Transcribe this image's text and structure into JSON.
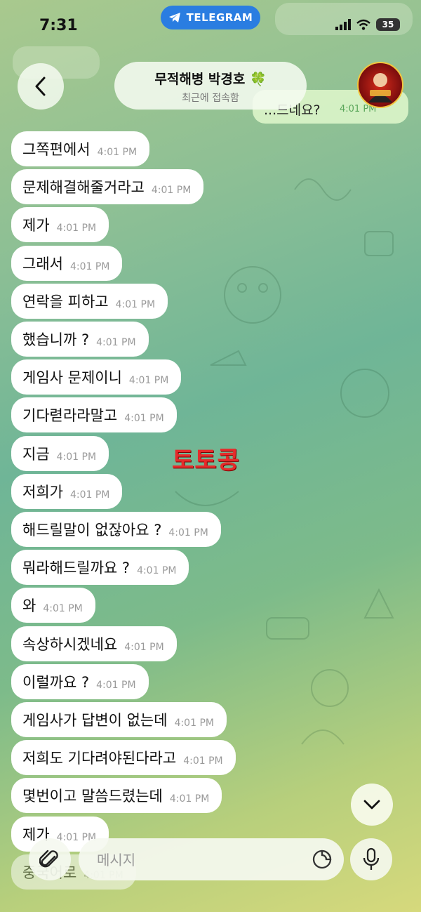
{
  "status_bar": {
    "time": "7:31",
    "app_pill": "TELEGRAM",
    "battery": "35"
  },
  "header": {
    "contact_name": "무적해병 박경호 🍀",
    "contact_status": "최근에 접속함"
  },
  "outgoing_partial": {
    "text": "...드네요?",
    "time": "4:01 PM"
  },
  "messages": [
    {
      "text": "그쪽편에서",
      "time": "4:01 PM"
    },
    {
      "text": "문제해결해줄거라고",
      "time": "4:01 PM"
    },
    {
      "text": "제가",
      "time": "4:01 PM"
    },
    {
      "text": "그래서",
      "time": "4:01 PM"
    },
    {
      "text": "연락을 피하고",
      "time": "4:01 PM"
    },
    {
      "text": "했습니까 ?",
      "time": "4:01 PM"
    },
    {
      "text": "게임사 문제이니",
      "time": "4:01 PM"
    },
    {
      "text": "기다렫라라말고",
      "time": "4:01 PM"
    },
    {
      "text": "지금",
      "time": "4:01 PM"
    },
    {
      "text": "저희가",
      "time": "4:01 PM"
    },
    {
      "text": "해드릴말이 없잖아요 ?",
      "time": "4:01 PM"
    },
    {
      "text": "뭐라해드릴까요 ?",
      "time": "4:01 PM"
    },
    {
      "text": "와",
      "time": "4:01 PM"
    },
    {
      "text": "속상하시겠네요",
      "time": "4:01 PM"
    },
    {
      "text": "이럴까요 ?",
      "time": "4:01 PM"
    },
    {
      "text": "게임사가 답변이 없는데",
      "time": "4:01 PM"
    },
    {
      "text": "저희도 기다려야된다라고",
      "time": "4:01 PM"
    },
    {
      "text": "몇번이고 말씀드렸는데",
      "time": "4:01 PM"
    },
    {
      "text": "제가",
      "time": "4:01 PM"
    },
    {
      "text": "중국어로",
      "time": "4:01 PM"
    }
  ],
  "watermark": "토토콩",
  "composer": {
    "placeholder": "메시지"
  }
}
